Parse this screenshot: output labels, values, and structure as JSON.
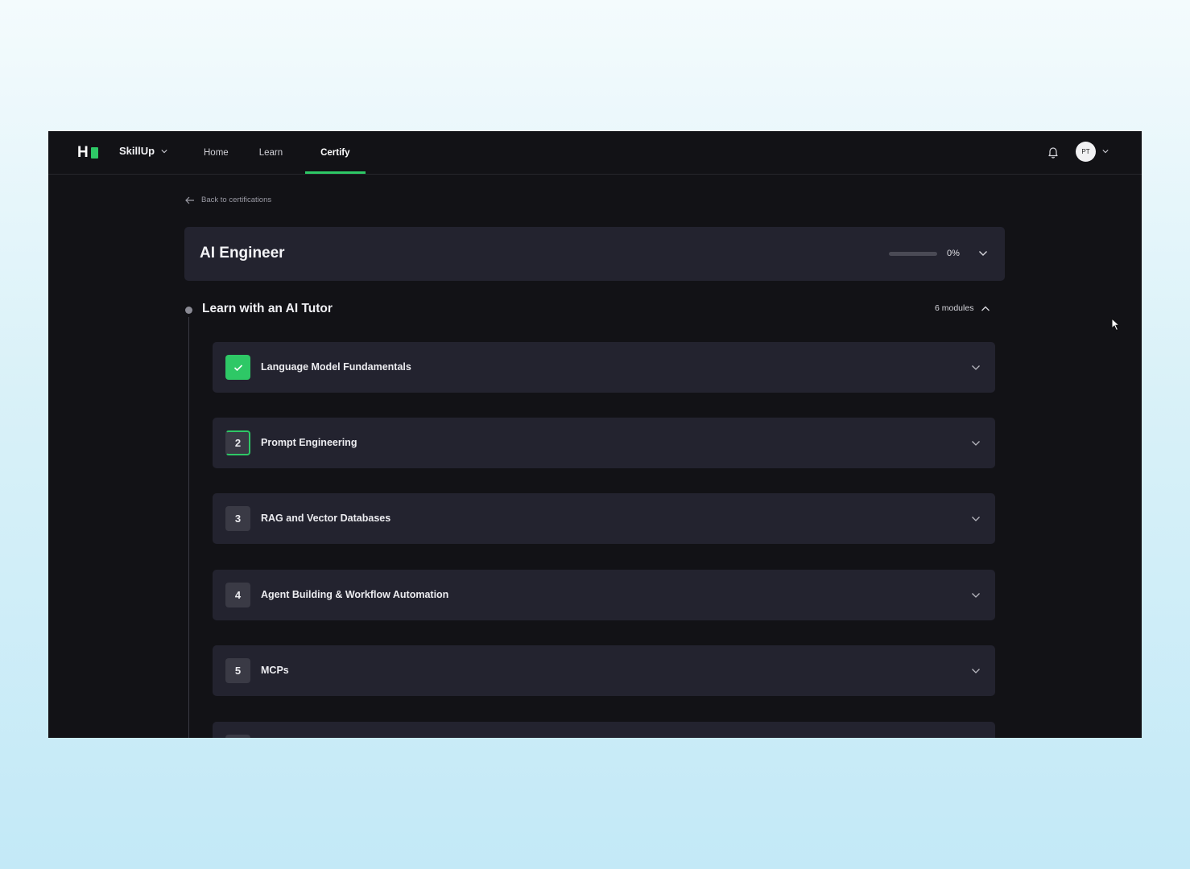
{
  "header": {
    "logo_text": "H",
    "brand": "SkillUp",
    "nav": [
      {
        "label": "Home",
        "active": false
      },
      {
        "label": "Learn",
        "active": false
      },
      {
        "label": "Certify",
        "active": true
      }
    ],
    "avatar_initials": "PT"
  },
  "back_link": "Back to certifications",
  "certification": {
    "title": "AI Engineer",
    "progress_percent": 0,
    "progress_label": "0%"
  },
  "section": {
    "title": "Learn with an AI Tutor",
    "modules_count_label": "6 modules",
    "modules": [
      {
        "number": "",
        "title": "Language Model Fundamentals",
        "status": "completed"
      },
      {
        "number": "2",
        "title": "Prompt Engineering",
        "status": "in-progress"
      },
      {
        "number": "3",
        "title": "RAG and Vector Databases",
        "status": "not-started"
      },
      {
        "number": "4",
        "title": "Agent Building & Workflow Automation",
        "status": "not-started"
      },
      {
        "number": "5",
        "title": "MCPs",
        "status": "not-started"
      }
    ]
  },
  "colors": {
    "accent": "#2ec866",
    "card": "#23232f",
    "background": "#121216"
  }
}
